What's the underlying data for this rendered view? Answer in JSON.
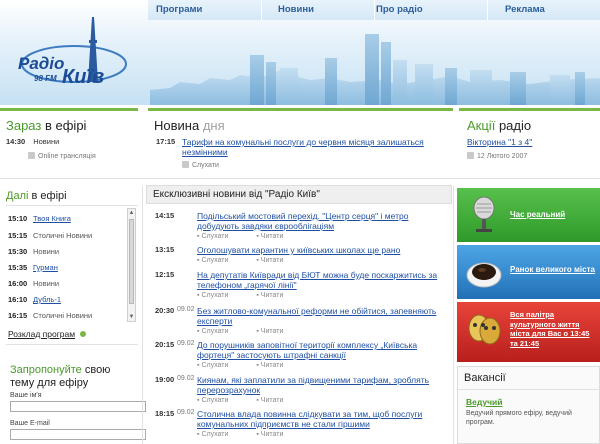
{
  "nav": {
    "items": [
      "Програми",
      "Новини",
      "Про радіо",
      "Реклама"
    ]
  },
  "logo": {
    "word1": "Радіо",
    "word2": "Київ",
    "freq": "98 FM"
  },
  "now_on_air": {
    "title_colored": "Зараз",
    "title_rest": "в ефірі",
    "time": "14:30",
    "show": "Новини",
    "stream_label": "Online трансляція"
  },
  "news_of_day": {
    "title_main": "Новина",
    "title_grey": "дня",
    "time": "17:15",
    "headline": "Тарифи на комунальні послуги до червня місяця залишаться незмінними",
    "listen": "Слухати"
  },
  "promo": {
    "title_colored": "Акції",
    "title_rest": "радіо",
    "link": "Вікторина \"1 з 4\"",
    "date": "12 Лютого 2007"
  },
  "schedule": {
    "title_colored": "Далі",
    "title_rest": "в ефірі",
    "rows": [
      {
        "time": "15:10",
        "name": "Твоя Книга",
        "link": true
      },
      {
        "time": "15:15",
        "name": "Столичні Новини",
        "link": false
      },
      {
        "time": "15:30",
        "name": "Новини",
        "link": false
      },
      {
        "time": "15:35",
        "name": "Гурман",
        "link": true
      },
      {
        "time": "16:00",
        "name": "Новини",
        "link": false
      },
      {
        "time": "16:10",
        "name": "Дубль-1",
        "link": true
      },
      {
        "time": "16:15",
        "name": "Столичні Новини",
        "link": false
      }
    ],
    "full_schedule": "Розклад програм"
  },
  "suggest": {
    "line1_colored": "Запропонуйте",
    "line1_rest": "свою",
    "line2": "тему для ефіру",
    "name_label": "Ваше ім'я",
    "email_label": "Ваше E-mail"
  },
  "exclusive": {
    "title": "Ексклюзивні новини від \"Радіо Київ\"",
    "listen": "Слухати",
    "read": "Читати",
    "items": [
      {
        "time": "14:15",
        "date": "",
        "title": "Подільський мостовий перехід. \"Центр серця\" і метро добудують завдяки єврооблігаціям"
      },
      {
        "time": "13:15",
        "date": "",
        "title": "Оголошувати карантин у київських школах ще рано"
      },
      {
        "time": "12:15",
        "date": "",
        "title": "На депутатів Київради від БЮТ можна буде поскаржитись за телефоном „гарячої лінії\""
      },
      {
        "time": "20:30",
        "date": "09.02",
        "title": "Без житлово-комунальної реформи не обійтися, запевняють експерти"
      },
      {
        "time": "20:15",
        "date": "09.02",
        "title": "До порушників заповітної території комплексу „Київська фортеця\" застосують штрафні санкції"
      },
      {
        "time": "19:00",
        "date": "09.02",
        "title": "Киянам, які заплатили за підвищеними тарифам, зроблять перерозрахунок"
      },
      {
        "time": "18:15",
        "date": "09.02",
        "title": "Столична влада повинна слідкувати за тим, щоб послуги комунальних підприємств не стали гіршими"
      }
    ]
  },
  "right_boxes": [
    {
      "label": "Час реальний",
      "color": "#3aa535"
    },
    {
      "label": "Ранок великого міста",
      "color": "#2f8ad2"
    },
    {
      "label": "Вся палітра культурного життя міста для Вас о 13:45 та 21:45",
      "color": "#d8302c"
    }
  ],
  "vacancies": {
    "title": "Вакансії",
    "link": "Ведучий",
    "desc": "Ведучий прямого ефіру, ведучий програм."
  },
  "colors": {
    "accent_green": "#4a9a2a",
    "link_blue": "#1f4fa3",
    "nav_blue": "#2b5e9c"
  }
}
